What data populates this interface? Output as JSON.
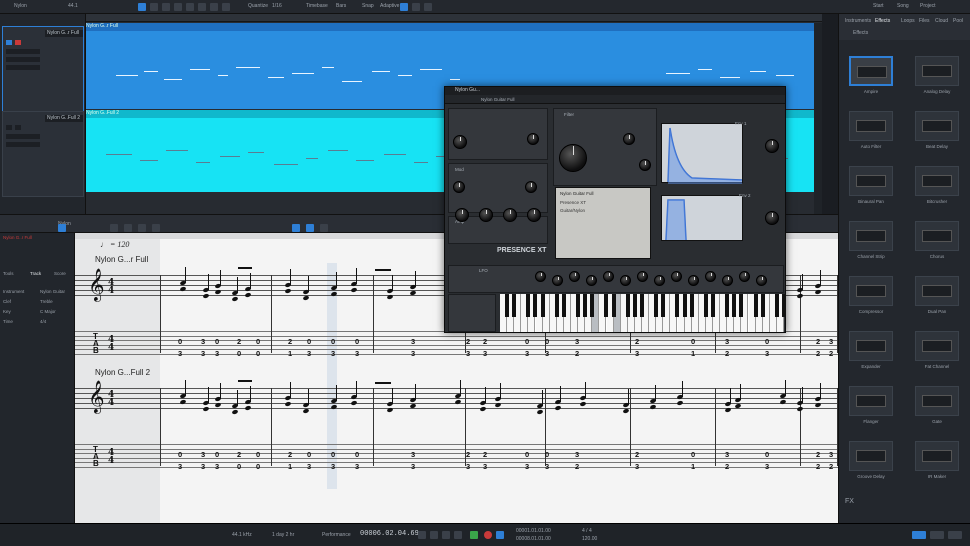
{
  "app": {
    "song_title": "Nylon",
    "accent": "#2e7fd6"
  },
  "toolbar": {
    "left_a": "Nylon",
    "left_b": "44.1",
    "items": [
      "Quantize",
      "1/16",
      "Timebase",
      "Bars",
      "Snap",
      "Adaptive"
    ],
    "right": [
      "Start",
      "Song",
      "Project"
    ]
  },
  "tracks": [
    {
      "name": "Nylon G..r Full",
      "lane_color": "#2a8ee0"
    },
    {
      "name": "Nylon G..Full 2",
      "lane_color": "#17e3f4"
    }
  ],
  "editor_toolbar": {
    "label": "Nylon"
  },
  "score_left_panel": {
    "tabs": [
      "Tools",
      "Track",
      "Score"
    ],
    "rows": [
      "Nylon G..r Full",
      "Instrument",
      "Nylon Guitar",
      "Clef",
      "Treble",
      "Key",
      "C Major",
      "Time",
      "4/4"
    ]
  },
  "score": {
    "tempo": "♩ = 120",
    "staff1_label": "Nylon G...r Full",
    "staff2_label": "Nylon G...Full 2",
    "time_sig_top": "4",
    "time_sig_bottom": "4",
    "tab_clef": "T A B",
    "staff1_tab_row1": [
      "0",
      "3",
      "0",
      "2",
      "0",
      "2",
      "0",
      "0",
      "0",
      "3",
      "2",
      "2",
      "0",
      "0",
      "3",
      "2",
      "0",
      "3",
      "0",
      "2",
      "3"
    ],
    "staff1_tab_row2": [
      "3",
      "3",
      "3",
      "0",
      "0",
      "1",
      "3",
      "3",
      "3",
      "3",
      "3",
      "3",
      "3",
      "3",
      "2",
      "3",
      "1",
      "2",
      "3",
      "2",
      "2"
    ],
    "staff2_tab_row1": [
      "0",
      "3",
      "0",
      "2",
      "0",
      "2",
      "0",
      "0",
      "0",
      "3",
      "2",
      "2",
      "0",
      "0",
      "3",
      "2",
      "0",
      "3",
      "0",
      "2",
      "3"
    ],
    "staff2_tab_row2": [
      "3",
      "3",
      "3",
      "0",
      "0",
      "1",
      "3",
      "3",
      "3",
      "3",
      "3",
      "3",
      "3",
      "3",
      "2",
      "3",
      "1",
      "2",
      "3",
      "2",
      "2"
    ]
  },
  "plugin": {
    "title": "Nylon Gu...",
    "preset": "Nylon Guitar Full",
    "brand": "PRESENCE XT",
    "sections": [
      "Filter",
      "Amp",
      "Mod",
      "Env 1",
      "Env 2",
      "LFO"
    ],
    "lcd_lines": [
      "Nylon Guitar Full",
      "Presence XT",
      "Guitar/Nylon"
    ]
  },
  "browser": {
    "tabs": [
      "Instruments",
      "Effects",
      "Loops",
      "Files",
      "Cloud",
      "Pool"
    ],
    "header": "Effects",
    "items": [
      {
        "name": "Ampire",
        "selected": true
      },
      {
        "name": "Analog Delay"
      },
      {
        "name": "Auto Filter"
      },
      {
        "name": "Beat Delay"
      },
      {
        "name": "Binaural Pan"
      },
      {
        "name": "Bitcrusher"
      },
      {
        "name": "Channel Strip"
      },
      {
        "name": "Chorus"
      },
      {
        "name": "Compressor"
      },
      {
        "name": "Dual Pan"
      },
      {
        "name": "Expander"
      },
      {
        "name": "Fat Channel"
      },
      {
        "name": "Flanger"
      },
      {
        "name": "Gate"
      },
      {
        "name": "Groove Delay"
      },
      {
        "name": "IR Maker"
      }
    ],
    "footer": "FX"
  },
  "transport": {
    "sample_rate": "44.1 kHz",
    "length": "1 day 2 hr",
    "time": "00006.02.04.69",
    "start": "00001.01.01.00",
    "end": "00008.01.01.00",
    "tempo": "120.00",
    "signature": "4 / 4",
    "performance": "Performance"
  }
}
